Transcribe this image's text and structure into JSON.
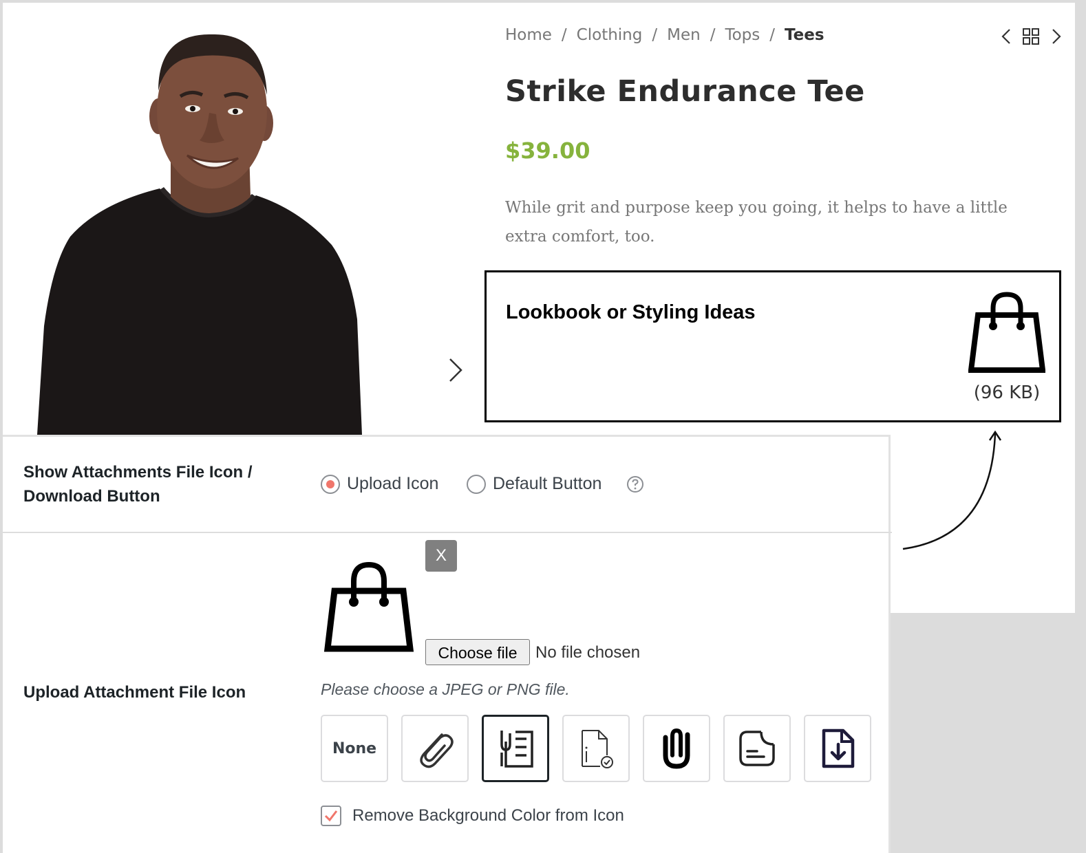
{
  "breadcrumb": {
    "home": "Home",
    "clothing": "Clothing",
    "men": "Men",
    "tops": "Tops",
    "current": "Tees",
    "separator": "/"
  },
  "product": {
    "title": "Strike Endurance Tee",
    "price": "$39.00",
    "description": "While grit and purpose keep you going, it helps to have a little extra comfort, too."
  },
  "attachment": {
    "title": "Lookbook or Styling Ideas",
    "size": "(96 KB)",
    "icon": "shopping-bag-icon"
  },
  "settings": {
    "show_label": "Show Attachments File Icon / Download Button",
    "radio_upload": "Upload Icon",
    "radio_default": "Default Button",
    "radio_selected": "Upload Icon",
    "upload_label": "Upload Attachment File Icon",
    "remove_button": "X",
    "choose_file": "Choose file",
    "file_status": "No file chosen",
    "file_hint": "Please choose a JPEG or PNG file.",
    "icon_options": [
      "None",
      "paperclip-icon",
      "clipped-list-icon",
      "document-check-icon",
      "bold-paperclip-icon",
      "sticky-note-icon",
      "file-download-icon"
    ],
    "selected_icon": "clipped-list-icon",
    "none_label": "None",
    "remove_bg_label": "Remove Background Color from Icon",
    "remove_bg_checked": true
  },
  "colors": {
    "price": "#86b33d",
    "radio_accent": "#f0766b",
    "download_icon": "#1e1b3a"
  }
}
